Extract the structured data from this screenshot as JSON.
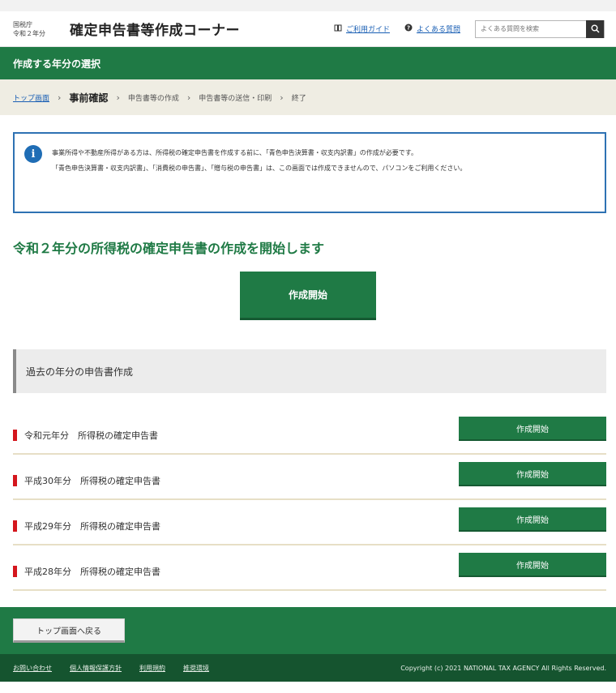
{
  "header": {
    "agency_line1": "国税庁",
    "agency_line2": "令和２年分",
    "title": "確定申告書等作成コーナー",
    "guide_label": "ご利用ガイド",
    "faq_label": "よくある質問",
    "search_placeholder": "よくある質問を検索"
  },
  "page_bar": {
    "title": "作成する年分の選択"
  },
  "breadcrumb": {
    "items": [
      "トップ画面",
      "事前確認",
      "申告書等の作成",
      "申告書等の送信・印刷",
      "終了"
    ]
  },
  "notice": {
    "line1": "事業所得や不動産所得がある方は、所得税の確定申告書を作成する前に、「青色申告決算書・収支内訳書」の作成が必要です。",
    "line2": "「青色申告決算書・収支内訳書」、「消費税の申告書」、「贈与税の申告書」は、この画面では作成できませんので、パソコンをご利用ください。"
  },
  "main": {
    "heading": "令和２年分の所得税の確定申告書の作成を開始します",
    "start_button": "作成開始"
  },
  "past": {
    "heading": "過去の年分の申告書作成",
    "items": [
      {
        "label": "令和元年分　所得税の確定申告書",
        "button": "作成開始"
      },
      {
        "label": "平成30年分　所得税の確定申告書",
        "button": "作成開始"
      },
      {
        "label": "平成29年分　所得税の確定申告書",
        "button": "作成開始"
      },
      {
        "label": "平成28年分　所得税の確定申告書",
        "button": "作成開始"
      }
    ]
  },
  "footer": {
    "back_button": "トップ画面へ戻る",
    "links": [
      "お問い合わせ",
      "個人情報保護方針",
      "利用規約",
      "推奨環境"
    ],
    "copyright": "Copyright (c) 2021 NATIONAL TAX AGENCY All Rights Reserved."
  },
  "colors": {
    "primary_green": "#1f7a45",
    "dark_green": "#15542f",
    "notice_border": "#2e72b3",
    "marker_red": "#d4161d"
  }
}
